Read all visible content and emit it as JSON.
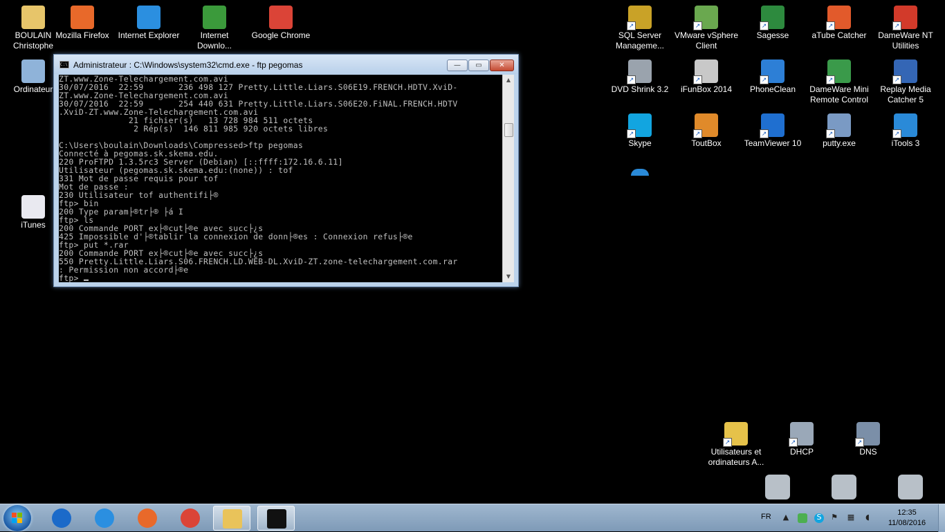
{
  "desktop": {
    "icons_left": [
      {
        "name": "folder-user-icon",
        "label": "BOULAIN\nChristophe",
        "color": "#e7c56a"
      },
      {
        "name": "firefox-icon",
        "label": "Mozilla Firefox",
        "color": "#e8692a"
      },
      {
        "name": "internet-explorer-icon",
        "label": "Internet Explorer",
        "color": "#2b8fe0"
      },
      {
        "name": "internet-download-manager-icon",
        "label": "Internet\nDownlo...",
        "color": "#3b9a3b"
      },
      {
        "name": "chrome-icon",
        "label": "Google Chrome",
        "color": "#db4437"
      },
      {
        "name": "computer-icon",
        "label": "Ordinateur",
        "color": "#8fb3d9"
      },
      {
        "name": "itunes-icon",
        "label": "iTunes",
        "color": "#e9e9f0"
      }
    ],
    "icons_right": [
      {
        "name": "sql-server-icon",
        "label": "SQL Server\nManageme...",
        "color": "#c9a227"
      },
      {
        "name": "vmware-vsphere-icon",
        "label": "VMware vSphere\nClient",
        "color": "#6aa84f"
      },
      {
        "name": "sagesse-icon",
        "label": "Sagesse",
        "color": "#2d8a3e"
      },
      {
        "name": "atube-catcher-icon",
        "label": "aTube Catcher",
        "color": "#e25a2b"
      },
      {
        "name": "dameware-nt-icon",
        "label": "DameWare NT\nUtilities",
        "color": "#d23a2a"
      },
      {
        "name": "dvd-shrink-icon",
        "label": "DVD Shrink 3.2",
        "color": "#9aa3ad"
      },
      {
        "name": "ifunbox-icon",
        "label": "iFunBox 2014",
        "color": "#c8c8c8"
      },
      {
        "name": "phoneclean-icon",
        "label": "PhoneClean",
        "color": "#2d7fd6"
      },
      {
        "name": "dameware-mini-remote-icon",
        "label": "DameWare Mini\nRemote Control",
        "color": "#3a9a4a"
      },
      {
        "name": "replay-media-catcher-icon",
        "label": "Replay Media\nCatcher 5",
        "color": "#3466b5"
      },
      {
        "name": "skype-icon",
        "label": "Skype",
        "color": "#12a5e0"
      },
      {
        "name": "toutbox-icon",
        "label": "ToutBox",
        "color": "#e08a2a"
      },
      {
        "name": "teamviewer-icon",
        "label": "TeamViewer 10",
        "color": "#1f6fd0"
      },
      {
        "name": "putty-icon",
        "label": "putty.exe",
        "color": "#7a9ac4"
      },
      {
        "name": "itools-icon",
        "label": "iTools 3",
        "color": "#2a8ad8"
      },
      {
        "name": "utilisateurs-ordinateurs-icon",
        "label": "Utilisateurs et\nordinateurs A...",
        "color": "#e6c24a"
      },
      {
        "name": "dhcp-icon",
        "label": "DHCP",
        "color": "#9aa8b8"
      },
      {
        "name": "dns-icon",
        "label": "DNS",
        "color": "#7b8fa8"
      }
    ]
  },
  "cmd_window": {
    "title": "Administrateur : C:\\Windows\\system32\\cmd.exe - ftp  pegomas",
    "minimize_label": "—",
    "maximize_label": "▭",
    "close_label": "✕",
    "lines": [
      "ZT.www.Zone-Telechargement.com.avi",
      "30/07/2016  22:59       236 498 127 Pretty.Little.Liars.S06E19.FRENCH.HDTV.XviD-",
      "ZT.www.Zone-Telechargement.com.avi",
      "30/07/2016  22:59       254 440 631 Pretty.Little.Liars.S06E20.FiNAL.FRENCH.HDTV",
      ".XviD-ZT.www.Zone-Telechargement.com.avi",
      "              21 fichier(s)   13 728 984 511 octets",
      "               2 Rép(s)  146 811 985 920 octets libres",
      "",
      "C:\\Users\\boulain\\Downloads\\Compressed>ftp pegomas",
      "Connecté à pegomas.sk.skema.edu.",
      "220 ProFTPD 1.3.5rc3 Server (Debian) [::ffff:172.16.6.11]",
      "Utilisateur (pegomas.sk.skema.edu:(none)) : tof",
      "331 Mot de passe requis pour tof",
      "Mot de passe :",
      "230 Utilisateur tof authentifi├®",
      "ftp> bin",
      "200 Type param├®tr├® ├á I",
      "ftp> ls",
      "200 Commande PORT ex├®cut├®e avec succ├¿s",
      "425 Impossible d'├®tablir la connexion de donn├®es : Connexion refus├®e",
      "ftp> put *.rar",
      "200 Commande PORT ex├®cut├®e avec succ├¿s",
      "550 Pretty.Little.Liars.S06.FRENCH.LD.WEB-DL.XviD-ZT.zone-telechargement.com.rar",
      ": Permission non accord├®e",
      "ftp> "
    ]
  },
  "taskbar": {
    "pinned": [
      {
        "name": "outlook-icon",
        "color": "#1b6ac9"
      },
      {
        "name": "internet-explorer-taskbar-icon",
        "color": "#2b8fe0"
      },
      {
        "name": "firefox-taskbar-icon",
        "color": "#e8692a"
      },
      {
        "name": "chrome-taskbar-icon",
        "color": "#db4437"
      },
      {
        "name": "file-explorer-taskbar-icon",
        "color": "#e9c35a"
      },
      {
        "name": "cmd-taskbar-icon",
        "color": "#111111"
      }
    ],
    "language": "FR",
    "time": "12:35",
    "date": "11/08/2016"
  }
}
